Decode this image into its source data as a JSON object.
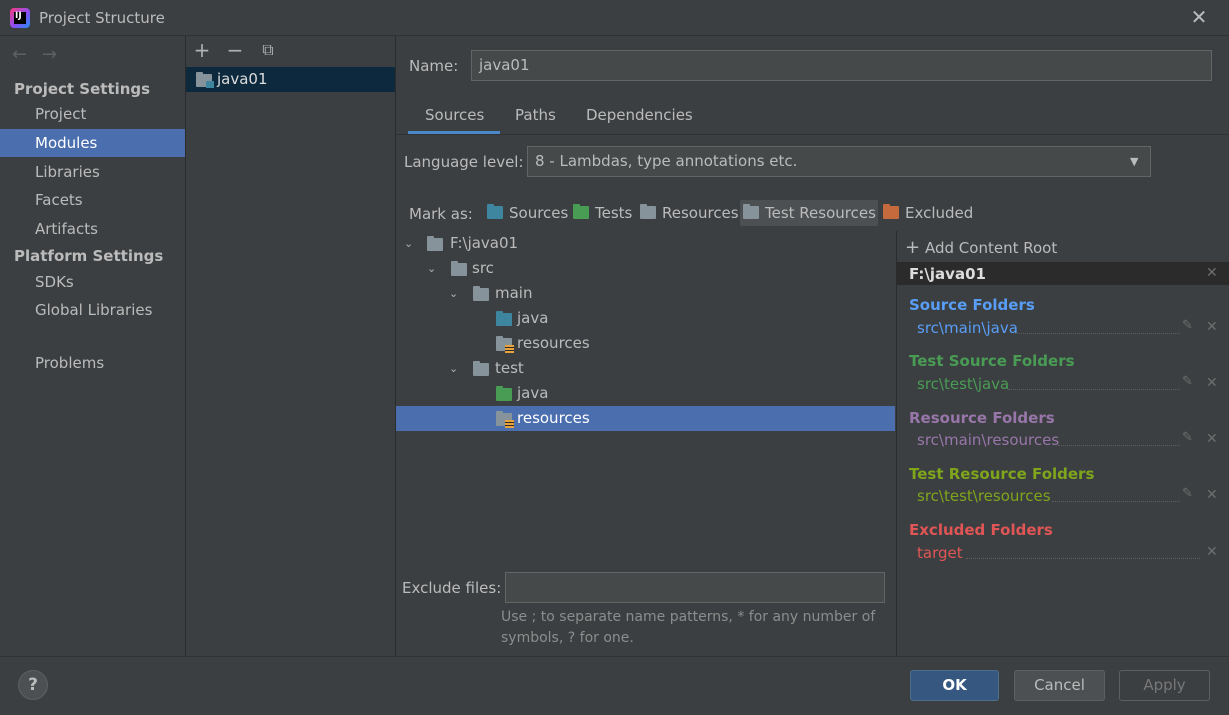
{
  "window": {
    "title": "Project Structure",
    "app_icon_text": "IJ"
  },
  "nav": {
    "back_glyph": "←",
    "forward_glyph": "→",
    "project_settings_header": "Project Settings",
    "platform_settings_header": "Platform Settings",
    "items": {
      "project": "Project",
      "modules": "Modules",
      "libraries": "Libraries",
      "facets": "Facets",
      "artifacts": "Artifacts",
      "sdks": "SDKs",
      "global_libraries": "Global Libraries",
      "problems": "Problems"
    },
    "selected": "Modules"
  },
  "modules": {
    "list": [
      "java01"
    ],
    "selected": "java01"
  },
  "module_detail": {
    "name_label": "Name:",
    "name_value": "java01",
    "tabs": [
      "Sources",
      "Paths",
      "Dependencies"
    ],
    "active_tab": "Sources",
    "language_level_label": "Language level:",
    "language_level_value": "8 - Lambdas, type annotations etc.",
    "mark_as_label": "Mark as:",
    "mark_as": {
      "sources": "Sources",
      "tests": "Tests",
      "resources": "Resources",
      "test_resources": "Test Resources",
      "excluded": "Excluded"
    },
    "tree": {
      "root": "F:\\java01",
      "src": "src",
      "main": "main",
      "main_java": "java",
      "main_resources": "resources",
      "test": "test",
      "test_java": "java",
      "test_resources": "resources",
      "selected": "resources"
    },
    "exclude_files_label": "Exclude files:",
    "exclude_files_value": "",
    "exclude_hint_line1": "Use ; to separate name patterns, * for any number of",
    "exclude_hint_line2": "symbols, ? for one."
  },
  "content_root": {
    "add_label": "Add Content Root",
    "root_path": "F:\\java01",
    "groups": {
      "source": {
        "title": "Source Folders",
        "path": "src\\main\\java",
        "color": "#589df6"
      },
      "test_source": {
        "title": "Test Source Folders",
        "path": "src\\test\\java",
        "color": "#499c54"
      },
      "resource": {
        "title": "Resource Folders",
        "path": "src\\main\\resources",
        "color": "#9876aa"
      },
      "test_resource": {
        "title": "Test Resource Folders",
        "path": "src\\test\\resources",
        "color": "#7fa51c"
      },
      "excluded": {
        "title": "Excluded Folders",
        "path": "target",
        "color": "#e05555"
      }
    }
  },
  "footer": {
    "help": "?",
    "ok": "OK",
    "cancel": "Cancel",
    "apply": "Apply"
  },
  "colors": {
    "selection": "#4b6eaf",
    "accent_tab": "#4a88c7",
    "source_folder": "#3e86a0",
    "test_folder": "#499c54",
    "excluded_folder": "#c46a3c"
  },
  "icons": {
    "add": "plus-icon",
    "remove": "minus-icon",
    "copy": "copy-icon",
    "close": "close-icon",
    "edit": "pencil-icon",
    "dropdown": "chevron-down-icon",
    "folder": "folder-icon"
  }
}
